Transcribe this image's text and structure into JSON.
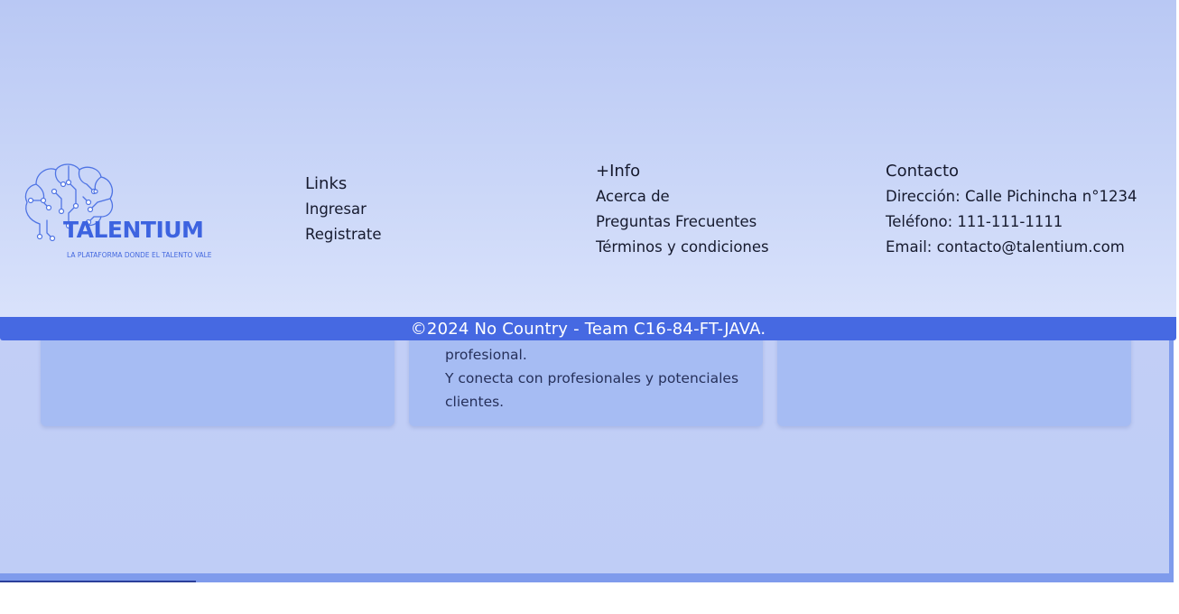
{
  "brand": {
    "name": "TALENTIUM",
    "tagline": "LA PLATAFORMA DONDE EL TALENTO VALE",
    "logo_icon": "brain-circuit-icon",
    "color": "#3d63e0"
  },
  "footer": {
    "links": {
      "title": "Links",
      "items": [
        "Ingresar",
        "Registrate"
      ]
    },
    "info": {
      "title": "+Info",
      "items": [
        "Acerca de",
        "Preguntas Frecuentes",
        "Términos y condiciones"
      ]
    },
    "contact": {
      "title": "Contacto",
      "address": "Dirección: Calle Pichincha n°1234",
      "phone": "Teléfono: 111-111-1111",
      "email": "Email: contacto@talentium.com"
    },
    "copyright": "©2024 No Country - Team C16-84-FT-JAVA.",
    "bar_color": "#4669e2"
  },
  "cards": {
    "middle_lines": [
      "profesional.",
      "Y conecta con profesionales y potenciales clientes."
    ]
  }
}
